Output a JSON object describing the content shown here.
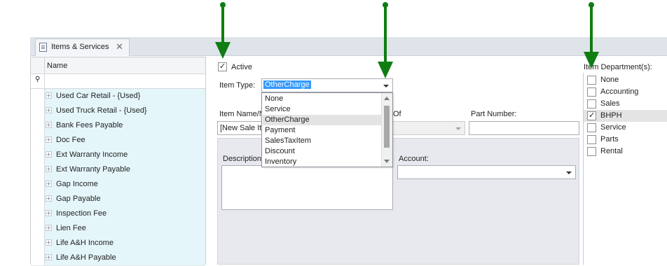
{
  "tab": {
    "label": "Items & Services",
    "close": "✕"
  },
  "grid": {
    "header": "Name",
    "filter_pin": "📍",
    "rows": [
      "Used Car Retail - {Used}",
      "Used Truck Retail - {Used}",
      "Bank Fees Payable",
      "Doc Fee",
      "Ext Warranty Income",
      "Ext Warranty Payable",
      "Gap Income",
      "Gap Payable",
      "Inspection Fee",
      "Lien Fee",
      "Life A&H Income",
      "Life A&H Payable"
    ]
  },
  "form": {
    "active_label": "Active",
    "active_checked": true,
    "item_type_label": "Item Type:",
    "item_type_value": "OtherCharge",
    "item_name_label": "Item Name/N",
    "item_name_value": "[New Sale Ite",
    "of_label": "Of",
    "part_number_label": "Part Number:",
    "part_number_value": "",
    "description_label": "Description",
    "account_label": "Account:",
    "account_value": ""
  },
  "dropdown": {
    "options": [
      "None",
      "Service",
      "OtherCharge",
      "Payment",
      "SalesTaxItem",
      "Discount",
      "Inventory"
    ],
    "highlighted": "OtherCharge"
  },
  "departments": {
    "label": "Item Department(s):",
    "items": [
      {
        "name": "None",
        "checked": false
      },
      {
        "name": "Accounting",
        "checked": false
      },
      {
        "name": "Sales",
        "checked": false
      },
      {
        "name": "BHPH",
        "checked": true
      },
      {
        "name": "Service",
        "checked": false
      },
      {
        "name": "Parts",
        "checked": false
      },
      {
        "name": "Rental",
        "checked": false
      }
    ]
  },
  "colors": {
    "arrow": "#0f7d12",
    "selection": "#3399ff",
    "row_alt": "#e5f6fb"
  }
}
